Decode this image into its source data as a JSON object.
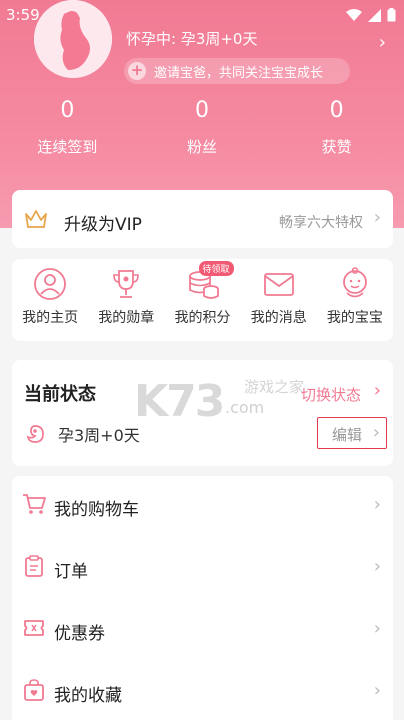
{
  "status_bar": {
    "time": "3:59"
  },
  "profile": {
    "pregnancy_status": "怀孕中: 孕3周+0天",
    "invite_text": "邀请宝爸，共同关注宝宝成长"
  },
  "stats": [
    {
      "value": "0",
      "label": "连续签到"
    },
    {
      "value": "0",
      "label": "粉丝"
    },
    {
      "value": "0",
      "label": "获赞"
    }
  ],
  "vip": {
    "title": "升级为VIP",
    "subtitle": "畅享六大特权"
  },
  "shortcuts": [
    {
      "label": "我的主页",
      "icon": "person-icon"
    },
    {
      "label": "我的勋章",
      "icon": "trophy-icon"
    },
    {
      "label": "我的积分",
      "icon": "coins-icon",
      "badge": "待领取"
    },
    {
      "label": "我的消息",
      "icon": "mail-icon"
    },
    {
      "label": "我的宝宝",
      "icon": "baby-icon"
    }
  ],
  "current_state": {
    "title": "当前状态",
    "switch_label": "切换状态",
    "state_text": "孕3周+0天",
    "edit_label": "编辑"
  },
  "watermark": {
    "main": "K73",
    "sub": "游戏之家",
    "domain": ".com"
  },
  "menu": [
    {
      "label": "我的购物车",
      "icon": "cart-icon"
    },
    {
      "label": "订单",
      "icon": "clipboard-icon"
    },
    {
      "label": "优惠券",
      "icon": "ticket-icon"
    },
    {
      "label": "我的收藏",
      "icon": "bag-icon"
    }
  ],
  "colors": {
    "accent": "#f17a93",
    "highlight_border": "#e43b4a"
  }
}
